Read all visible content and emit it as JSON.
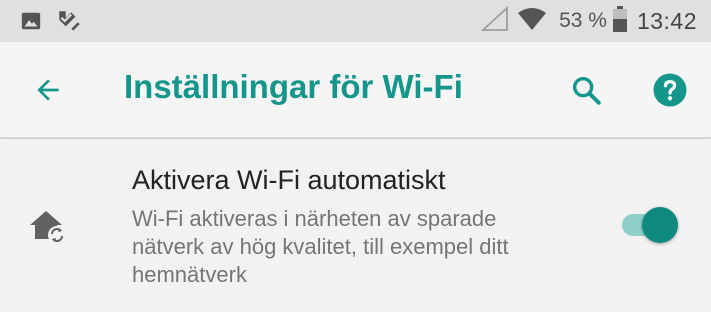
{
  "status_bar": {
    "left_icons": [
      "image-icon",
      "check-notification-icon"
    ],
    "right_icons": [
      "no-signal-icon",
      "wifi-icon",
      "battery-icon"
    ],
    "battery_percent": "53 %",
    "time": "13:42"
  },
  "app_bar": {
    "title": "Inställningar för Wi-Fi",
    "back_icon": "arrow-back-icon",
    "search_icon": "search-icon",
    "help_icon": "help-icon"
  },
  "setting": {
    "icon": "home-sync-icon",
    "title": "Aktivera Wi-Fi automatiskt",
    "summary": "Wi-Fi aktiveras i närheten av sparade nätverk av hög kvalitet, till exempel ditt hemnätverk",
    "enabled": true
  },
  "colors": {
    "accent": "#14968a",
    "toggle_thumb": "#0f8a7e",
    "toggle_track": "#8ecfc8",
    "status_bar_bg": "#e0e0e0",
    "app_bar_bg": "#f5f5f5"
  }
}
